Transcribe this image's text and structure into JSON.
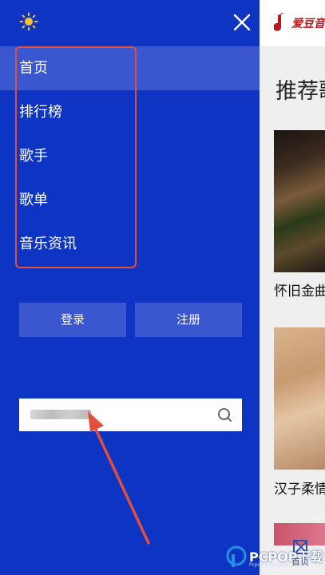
{
  "drawer": {
    "theme_icon": "sun-icon",
    "close_icon": "close-icon",
    "nav_items": [
      {
        "label": "首页",
        "active": true
      },
      {
        "label": "排行榜",
        "active": false
      },
      {
        "label": "歌手",
        "active": false
      },
      {
        "label": "歌单",
        "active": false
      },
      {
        "label": "音乐资讯",
        "active": false
      }
    ],
    "login_label": "登录",
    "register_label": "注册",
    "search": {
      "value": "",
      "placeholder": "",
      "icon": "search-icon"
    },
    "colors": {
      "drawer_bg": "#0e34c4",
      "item_highlight": "#3a57cf",
      "annotation": "#e2503b"
    }
  },
  "background_page": {
    "logo_text": "爱豆音",
    "section_title": "推荐歌",
    "cards": [
      {
        "title": "怀旧金曲"
      },
      {
        "title": "汉子柔情"
      }
    ],
    "tab_label": "首页"
  },
  "watermark": {
    "text": "PCPOP下载",
    "sub": "Pcpop Download"
  }
}
